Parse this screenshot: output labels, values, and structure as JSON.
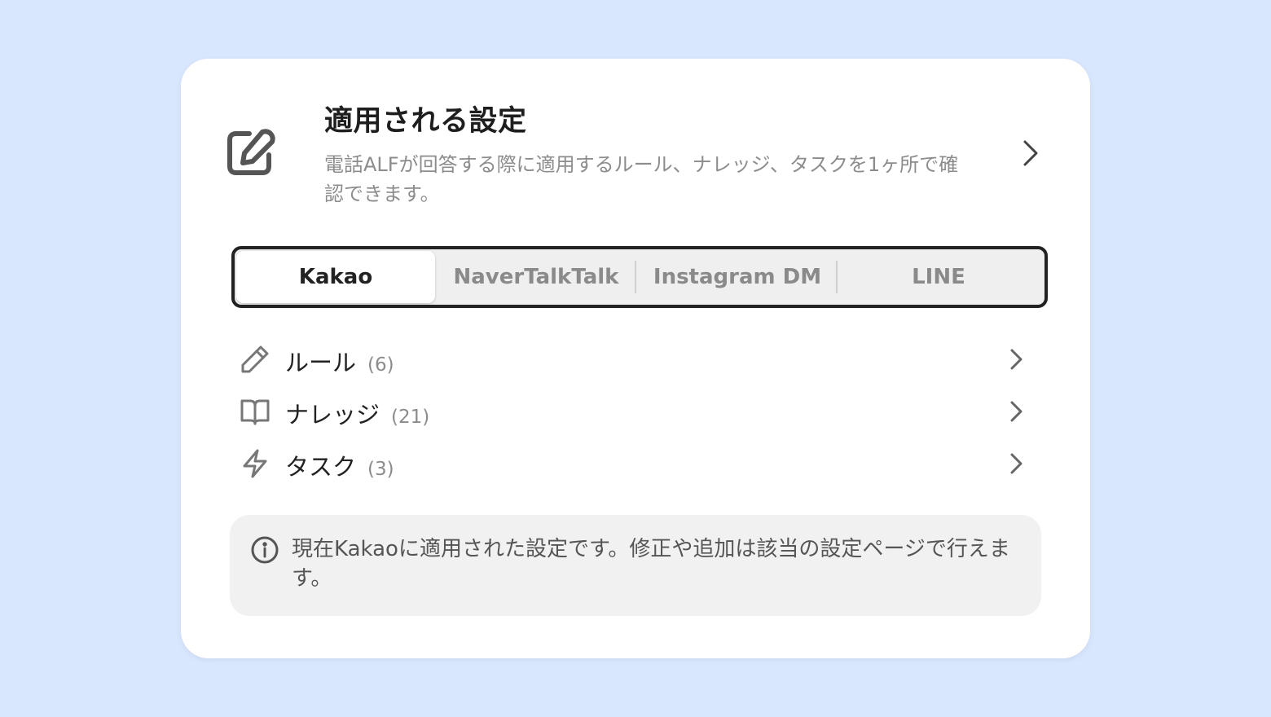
{
  "header": {
    "title": "適用される設定",
    "description": "電話ALFが回答する際に適用するルール、ナレッジ、タスクを1ヶ所で確認できます。",
    "icon": "edit-square-icon",
    "chevron": "chevron-right-icon"
  },
  "tabs": [
    {
      "label": "Kakao",
      "active": true
    },
    {
      "label": "NaverTalkTalk",
      "active": false
    },
    {
      "label": "Instagram DM",
      "active": false
    },
    {
      "label": "LINE",
      "active": false
    }
  ],
  "items": [
    {
      "label": "ルール",
      "count": "(6)",
      "icon": "pencil-icon"
    },
    {
      "label": "ナレッジ",
      "count": "(21)",
      "icon": "book-icon"
    },
    {
      "label": "タスク",
      "count": "(3)",
      "icon": "lightning-icon"
    }
  ],
  "info": {
    "icon": "info-icon",
    "text": "現在Kakaoに適用された設定です。修正や追加は該当の設定ページで行えます。"
  },
  "colors": {
    "background": "#d8e6fe",
    "card": "#ffffff",
    "tab_border": "#222222",
    "info_bg": "#f1f1f1"
  }
}
